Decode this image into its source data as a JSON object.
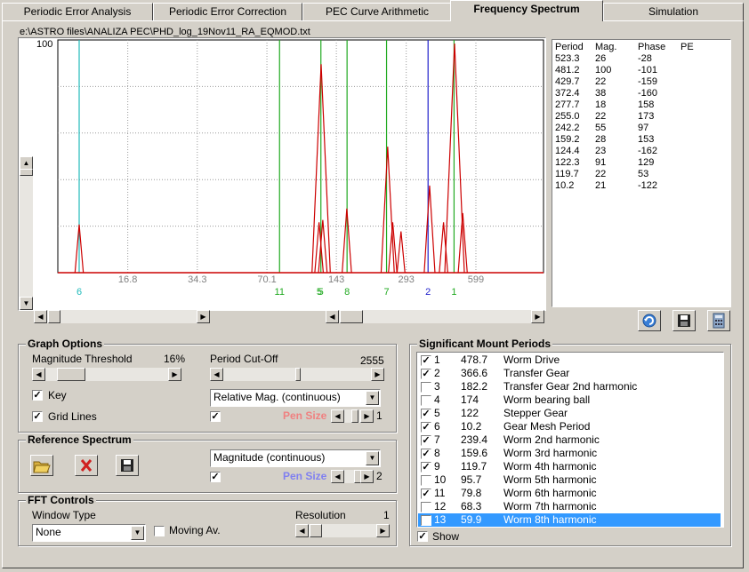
{
  "tabs": [
    "Periodic Error Analysis",
    "Periodic Error Correction",
    "PEC Curve Arithmetic",
    "Frequency Spectrum",
    "Simulation"
  ],
  "active_tab": "Frequency Spectrum",
  "file_path": "e:\\ASTRO files\\ANALIZA PEC\\PHD_log_19Nov11_RA_EQMOD.txt",
  "chart": {
    "y_top_label": "100",
    "x_tick_labels": [
      "16.8",
      "34.3",
      "70.1",
      "143",
      "293",
      "599"
    ],
    "marker_labels": [
      "6",
      "11",
      "5",
      "5",
      "8",
      "7",
      "2",
      "1"
    ]
  },
  "chart_data": {
    "type": "line",
    "ylim": [
      0,
      100
    ],
    "x_scale": "period (log)",
    "x_tick_labels": [
      "16.8",
      "34.3",
      "70.1",
      "143",
      "293",
      "599"
    ],
    "series": [
      {
        "values": [
          [
            10.2,
            21
          ],
          [
            119.7,
            22
          ],
          [
            122.3,
            91
          ],
          [
            124.4,
            23
          ],
          [
            159.2,
            28
          ],
          [
            242.2,
            55
          ],
          [
            255.0,
            22
          ],
          [
            277.7,
            18
          ],
          [
            372.4,
            38
          ],
          [
            429.7,
            22
          ],
          [
            481.2,
            100
          ],
          [
            523.3,
            26
          ]
        ]
      }
    ],
    "vertical_markers": [
      {
        "label": "6",
        "period": 10.2,
        "color": "#22bbbb"
      },
      {
        "label": "11",
        "period": 79.8,
        "color": "#22aa22"
      },
      {
        "label": "5",
        "period": 122,
        "color": "#22aa22"
      },
      {
        "label": "8",
        "period": 159.6,
        "color": "#22aa22"
      },
      {
        "label": "7",
        "period": 239.4,
        "color": "#22aa22"
      },
      {
        "label": "2",
        "period": 366.6,
        "color": "#2222cc"
      },
      {
        "label": "1",
        "period": 478.7,
        "color": "#22aa22"
      }
    ],
    "grid": true
  },
  "peaks_table": {
    "headers": [
      "Period",
      "Mag.",
      "Phase",
      "PE"
    ],
    "rows": [
      [
        "523.3",
        "26",
        "-28"
      ],
      [
        "481.2",
        "100",
        "-101"
      ],
      [
        "429.7",
        "22",
        "-159"
      ],
      [
        "372.4",
        "38",
        "-160"
      ],
      [
        "277.7",
        "18",
        "158"
      ],
      [
        "255.0",
        "22",
        "173"
      ],
      [
        "242.2",
        "55",
        "97"
      ],
      [
        "159.2",
        "28",
        "153"
      ],
      [
        "124.4",
        "23",
        "-162"
      ],
      [
        "122.3",
        "91",
        "129"
      ],
      [
        "119.7",
        "22",
        "53"
      ],
      [
        "10.2",
        "21",
        "-122"
      ]
    ]
  },
  "graph_options": {
    "title": "Graph Options",
    "magnitude_threshold_label": "Magnitude Threshold",
    "magnitude_threshold_value": "16%",
    "period_cutoff_label": "Period Cut-Off",
    "period_cutoff_value": "2555",
    "key_label": "Key",
    "key_checked": true,
    "grid_lines_label": "Grid Lines",
    "grid_lines_checked": true,
    "mag_mode": "Relative Mag. (continuous)",
    "pen_checked": true,
    "pen_size_label": "Pen Size",
    "pen_size_value": "1",
    "pen_color": "#f08080"
  },
  "reference_spectrum": {
    "title": "Reference Spectrum",
    "mode": "Magnitude (continuous)",
    "pen_checked": true,
    "pen_size_label": "Pen Size",
    "pen_size_value": "2",
    "pen_color": "#8080f0"
  },
  "fft_controls": {
    "title": "FFT Controls",
    "window_type_label": "Window Type",
    "window_type_value": "None",
    "moving_av_label": "Moving Av.",
    "moving_av_checked": false,
    "resolution_label": "Resolution",
    "resolution_value": "1"
  },
  "mount_periods": {
    "title": "Significant Mount Periods",
    "rows": [
      {
        "checked": true,
        "n": "1",
        "period": "478.7",
        "name": "Worm Drive"
      },
      {
        "checked": true,
        "n": "2",
        "period": "366.6",
        "name": "Transfer Gear"
      },
      {
        "checked": false,
        "n": "3",
        "period": "182.2",
        "name": "Transfer Gear 2nd harmonic"
      },
      {
        "checked": false,
        "n": "4",
        "period": "174",
        "name": "Worm bearing ball"
      },
      {
        "checked": true,
        "n": "5",
        "period": "122",
        "name": "Stepper Gear"
      },
      {
        "checked": true,
        "n": "6",
        "period": "10.2",
        "name": "Gear Mesh Period"
      },
      {
        "checked": true,
        "n": "7",
        "period": "239.4",
        "name": "Worm 2nd harmonic"
      },
      {
        "checked": true,
        "n": "8",
        "period": "159.6",
        "name": "Worm 3rd harmonic"
      },
      {
        "checked": true,
        "n": "9",
        "period": "119.7",
        "name": "Worm 4th harmonic"
      },
      {
        "checked": false,
        "n": "10",
        "period": "95.7",
        "name": "Worm 5th harmonic"
      },
      {
        "checked": true,
        "n": "11",
        "period": "79.8",
        "name": "Worm 6th harmonic"
      },
      {
        "checked": false,
        "n": "12",
        "period": "68.3",
        "name": "Worm 7th harmonic"
      },
      {
        "checked": false,
        "n": "13",
        "period": "59.9",
        "name": "Worm 8th harmonic",
        "selected": true
      }
    ],
    "show_label": "Show",
    "show_checked": true
  },
  "colors": {
    "selection": "#3399ff",
    "spectrum": "#cc0000",
    "cyan_marker": "#22bbbb",
    "green_marker": "#22aa22",
    "blue_marker": "#2222cc"
  }
}
